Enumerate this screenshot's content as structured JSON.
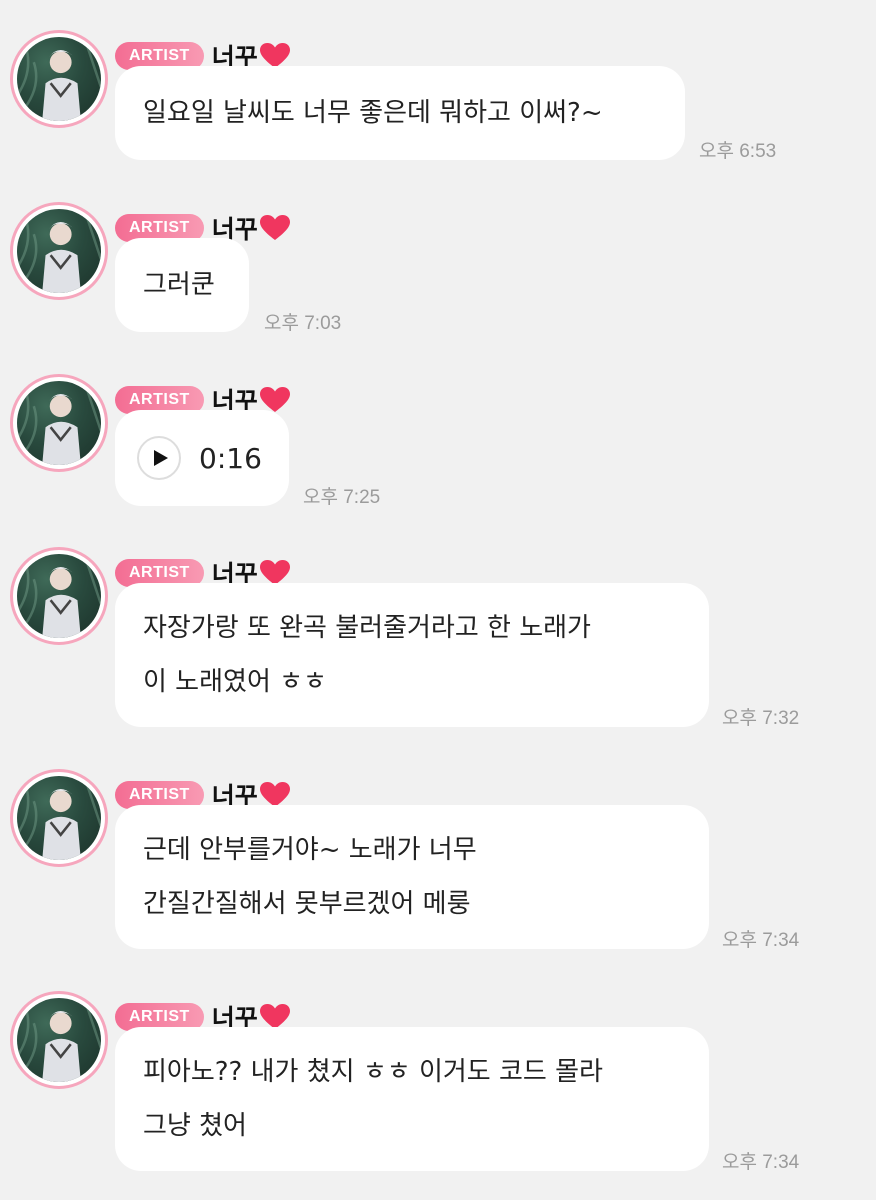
{
  "sender": {
    "badge": "ARTIST",
    "name": "너꾸",
    "heart_icon": "heart-icon",
    "heart_color": "#f0365f"
  },
  "colors": {
    "background": "#f1f1f1",
    "bubble": "#ffffff",
    "badge": "#f36d93",
    "avatar_ring": "#f6a6bd",
    "time_text": "#9b9b9b"
  },
  "messages": [
    {
      "type": "text",
      "text": "일요일 날씨도 너무 좋은데 뭐하고 이써?~",
      "time": "오후 6:53"
    },
    {
      "type": "text",
      "text": "그러쿤",
      "time": "오후 7:03"
    },
    {
      "type": "voice",
      "icon": "play-icon",
      "duration": "0:16",
      "time": "오후 7:25"
    },
    {
      "type": "text",
      "text": "자장가랑 또 완곡 불러줄거라고 한 노래가\n이 노래였어 ㅎㅎ",
      "time": "오후 7:32"
    },
    {
      "type": "text",
      "text": "근데 안부를거야~ 노래가 너무\n간질간질해서 못부르겠어 메룽",
      "time": "오후 7:34"
    },
    {
      "type": "text",
      "text": "피아노?? 내가 쳤지 ㅎㅎ 이거도 코드 몰라\n그냥 쳤어",
      "time": "오후 7:34"
    }
  ]
}
